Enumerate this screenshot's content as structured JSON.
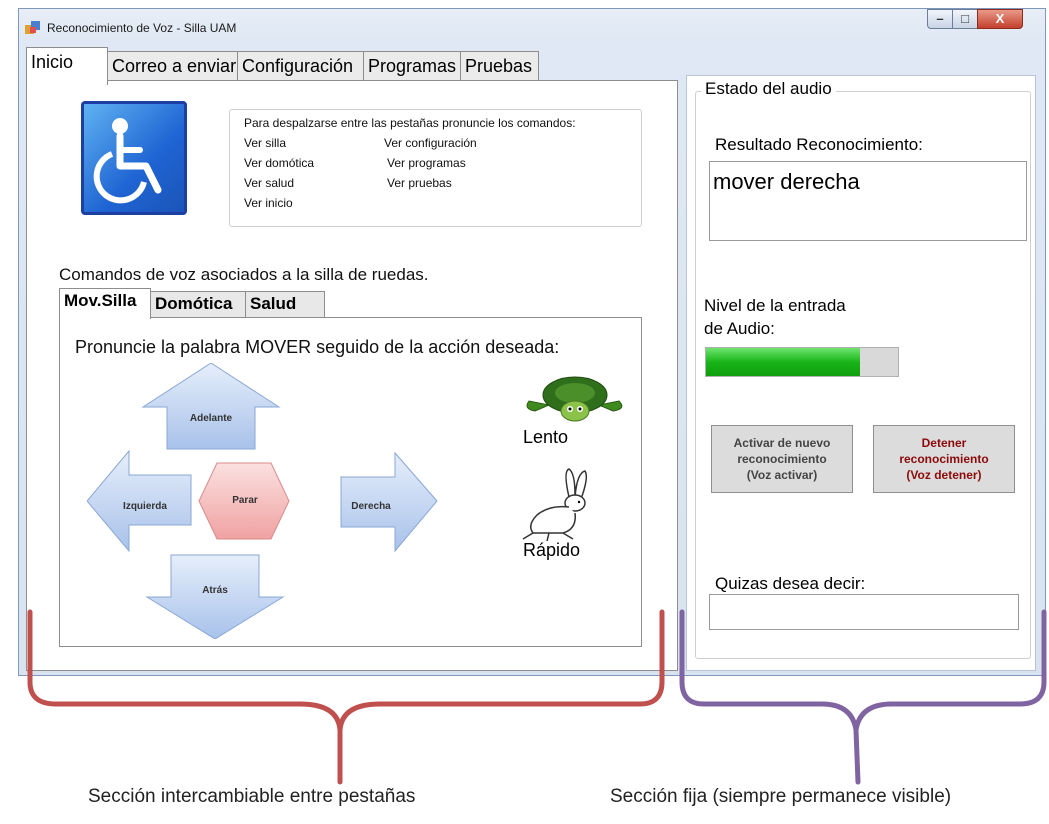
{
  "window": {
    "title": "Reconocimiento de Voz - Silla UAM",
    "min_glyph": "–",
    "max_glyph": "□",
    "close_glyph": "X"
  },
  "tabs": [
    {
      "label": "Inicio"
    },
    {
      "label": "Correo a enviar"
    },
    {
      "label": "Configuración"
    },
    {
      "label": "Programas"
    },
    {
      "label": "Pruebas"
    }
  ],
  "inicio": {
    "commands_intro": "Para despalzarse entre las pestañas pronuncie los comandos:",
    "commands_left": [
      "Ver silla",
      "Ver domótica",
      "Ver salud",
      "Ver inicio"
    ],
    "commands_right": [
      "Ver configuración",
      "Ver programas",
      "Ver pruebas"
    ],
    "voice_commands_label": "Comandos de voz asociados a la silla de ruedas.",
    "inner_tabs": [
      {
        "label": "Mov.Silla"
      },
      {
        "label": "Domótica"
      },
      {
        "label": "Salud"
      }
    ],
    "instruction": "Pronuncie la palabra MOVER seguido de la acción deseada:",
    "arrows": {
      "up": "Adelante",
      "left": "Izquierda",
      "center": "Parar",
      "right": "Derecha",
      "down": "Atrás"
    },
    "speed_slow": "Lento",
    "speed_fast": "Rápido"
  },
  "audio": {
    "group_title": "Estado del audio",
    "result_label": "Resultado Reconocimiento:",
    "result_value": "mover derecha",
    "level_label_line1": "Nivel de la entrada",
    "level_label_line2": "de Audio:",
    "level_fraction": 0.8,
    "activate_line1": "Activar de nuevo",
    "activate_line2": "reconocimiento",
    "activate_line3": "(Voz activar)",
    "stop_line1": "Detener",
    "stop_line2": "reconocimiento",
    "stop_line3": "(Voz detener)",
    "suggest_label": "Quizas desea decir:",
    "suggest_value": ""
  },
  "captions": {
    "left": "Sección intercambiable entre pestañas",
    "right": "Sección fija (siempre permanece visible)"
  },
  "colors": {
    "left_brace": "#c0504d",
    "right_brace": "#8064a2",
    "level_fill": "#19b519",
    "stop_text": "#8b0a0a"
  }
}
